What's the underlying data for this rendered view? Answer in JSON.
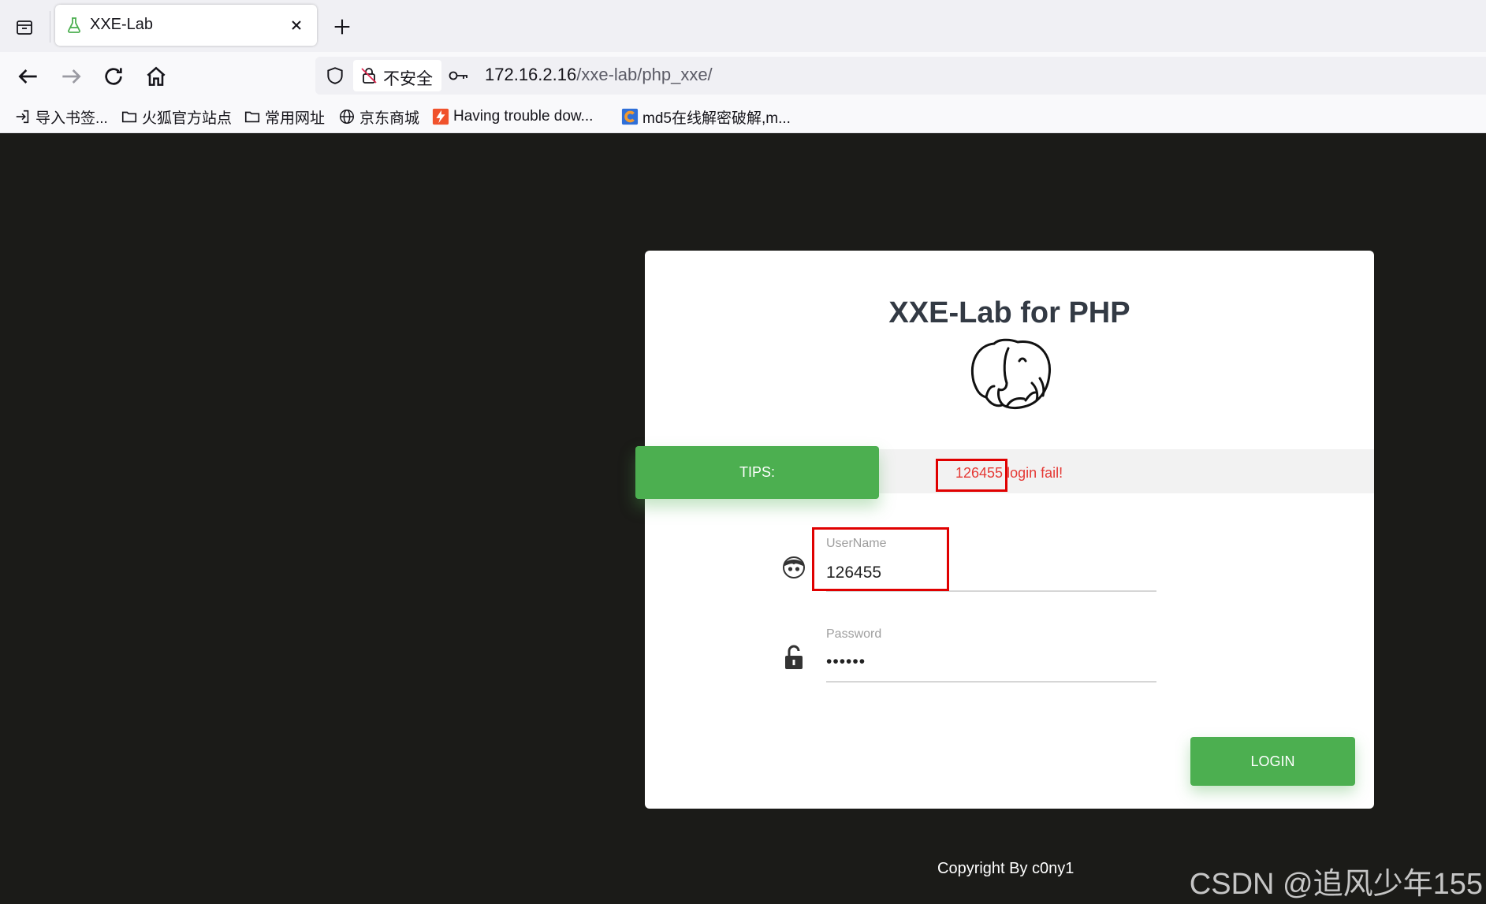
{
  "browser": {
    "tab_title": "XXE-Lab",
    "security_label": "不安全",
    "url_host": "172.16.2.16",
    "url_path": "/xxe-lab/php_xxe/",
    "bookmarks": [
      {
        "label": "导入书签..."
      },
      {
        "label": "火狐官方站点"
      },
      {
        "label": "常用网址"
      },
      {
        "label": "京东商城"
      },
      {
        "label": "Having trouble dow..."
      },
      {
        "label": "md5在线解密破解,m..."
      }
    ]
  },
  "page": {
    "title": "XXE-Lab for PHP",
    "tips_label": "TIPS:",
    "tip_message": "126455 login fail!",
    "username_label": "UserName",
    "username_value": "126455",
    "password_label": "Password",
    "password_value": "••••••",
    "login_label": "LOGIN",
    "copyright": "Copyright By c0ny1"
  },
  "watermark": "CSDN @追风少年155",
  "colors": {
    "accent_green": "#4caf50",
    "error_red": "#e53935",
    "page_background": "#1b1b18"
  }
}
